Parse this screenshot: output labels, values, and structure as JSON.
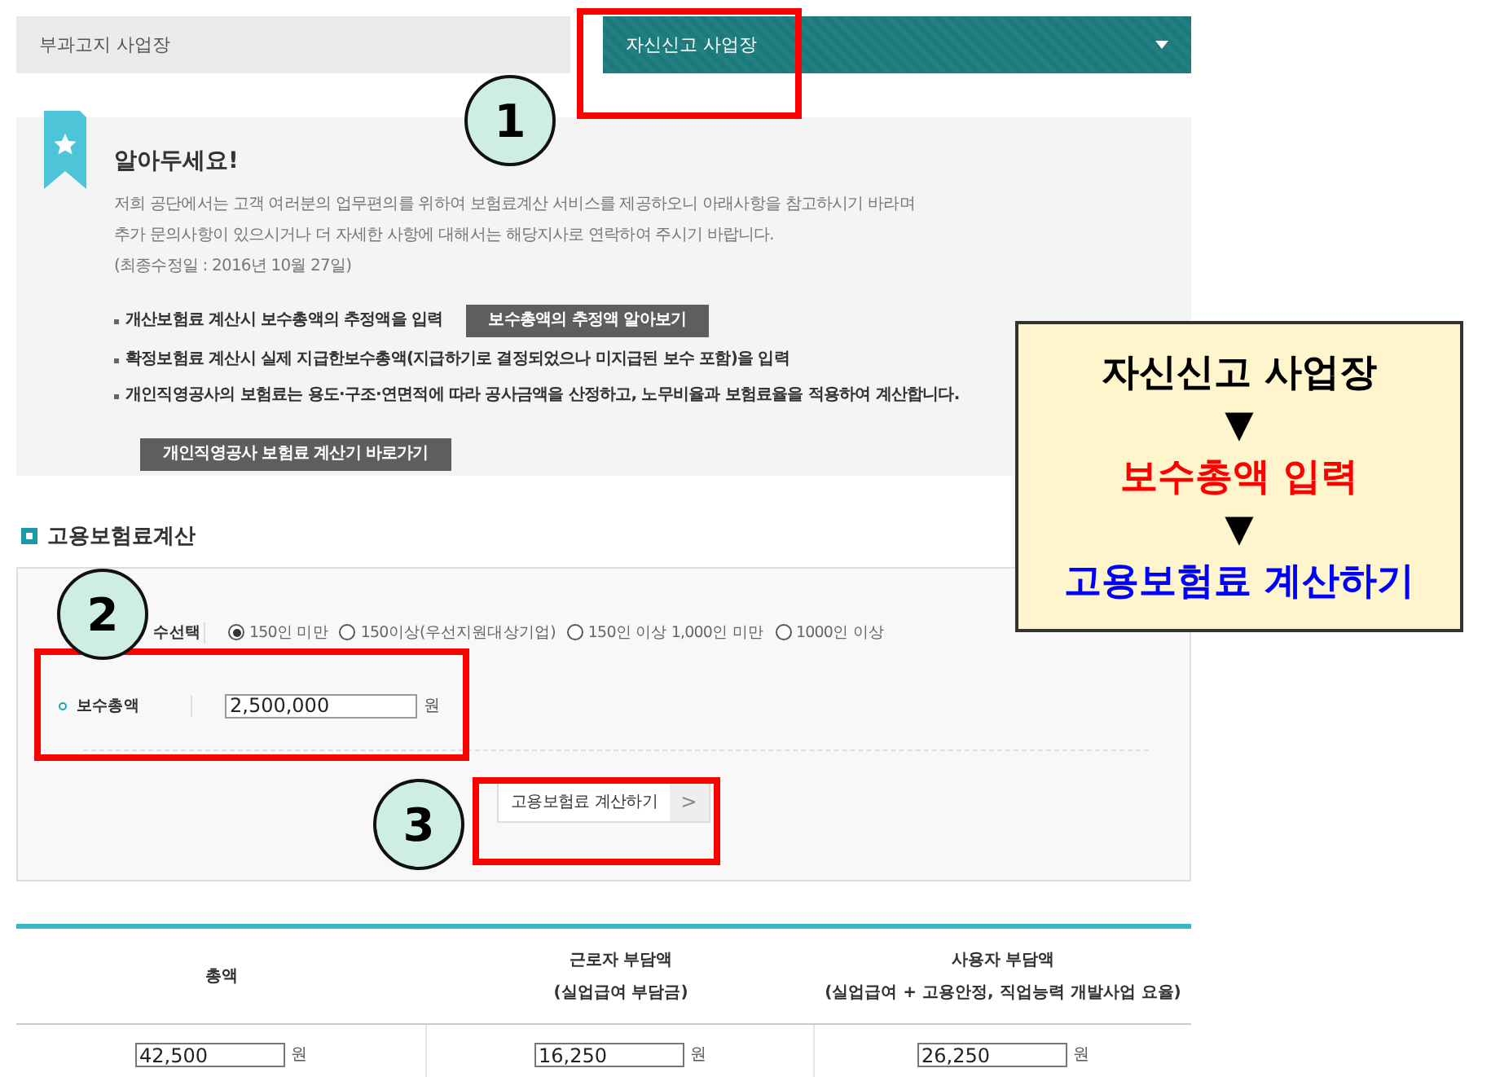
{
  "tabs": [
    {
      "label": "부과고지 사업장",
      "selected": false
    },
    {
      "label": "자신신고 사업장",
      "selected": true
    }
  ],
  "notice": {
    "title": "알아두세요!",
    "lines": [
      "저희 공단에서는 고객 여러분의 업무편의를 위하여 보험료계산 서비스를 제공하오니 아래사항을 참고하시기 바라며",
      "추가 문의사항이 있으시거나 더 자세한 사항에 대해서는 해당지사로 연락하여 주시기 바랍니다.",
      "(최종수정일 : 2016년 10월 27일)"
    ],
    "bullets": [
      {
        "text": "개산보험료 계산시 보수총액의 추정액을 입력",
        "link": "보수총액의 추정액 알아보기"
      },
      {
        "text": "확정보험료 계산시 실제 지급한보수총액(지급하기로 결정되었으나 미지급된 보수 포함)을 입력"
      },
      {
        "text": "개인직영공사의 보험료는 용도·구조·연면적에 따라 공사금액을 산정하고, 노무비율과 보험료율을 적용하여 계산합니다.",
        "link": "개인직영공사 보험료 계산기 바로가기"
      }
    ]
  },
  "section_title": "고용보험료계산",
  "form": {
    "size_label": "수선택",
    "sizes": [
      {
        "label": "150인 미만",
        "selected": true
      },
      {
        "label": "150이상(우선지원대상기업)",
        "selected": false
      },
      {
        "label": "150인 이상 1,000인 미만",
        "selected": false
      },
      {
        "label": "1000인 이상",
        "selected": false
      }
    ],
    "total_label": "보수총액",
    "total_value": "2,500,000",
    "unit": "원",
    "button": "고용보험료 계산하기",
    "button_arrow": ">"
  },
  "results": {
    "columns": [
      [
        "총액"
      ],
      [
        "근로자 부담액",
        "(실업급여 부담금)"
      ],
      [
        "사용자 부담액",
        "(실업급여 + 고용안정, 직업능력 개발사업 요율)"
      ]
    ],
    "values": [
      {
        "value": "42,500",
        "unit": "원"
      },
      {
        "value": "16,250",
        "unit": "원"
      },
      {
        "value": "26,250",
        "unit": "원"
      }
    ]
  },
  "annotations": {
    "markers": [
      "1",
      "2",
      "3"
    ],
    "callout": [
      {
        "text": "자신신고 사업장",
        "color": "#000000"
      },
      {
        "text": "▼",
        "color": "#000000"
      },
      {
        "text": "보수총액 입력",
        "color": "#ff0000"
      },
      {
        "text": "▼",
        "color": "#000000"
      },
      {
        "text": "고용보험료 계산하기",
        "color": "#0000ff"
      }
    ]
  }
}
